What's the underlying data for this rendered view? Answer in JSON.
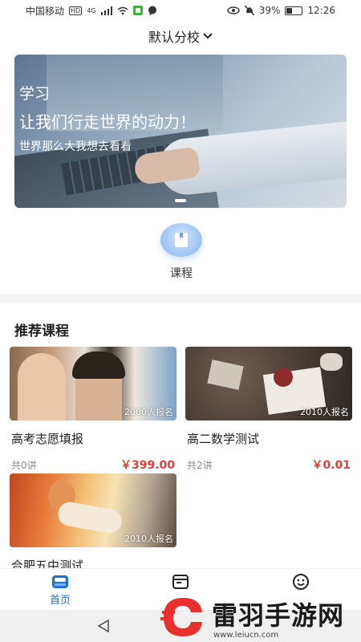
{
  "status_bar": {
    "carrier": "中国移动",
    "hd_badge": "HD",
    "network": "4G",
    "battery_percent": "39%",
    "battery_level": 0.39,
    "time": "12:26"
  },
  "header": {
    "campus": "默认分校"
  },
  "banner": {
    "line1": "学习",
    "line2": "让我们行走世界的动力！",
    "line3": "世界那么大我想去看看"
  },
  "quick_nav": {
    "course_label": "课程"
  },
  "section": {
    "title": "推荐课程",
    "courses": [
      {
        "title": "高考志愿填报",
        "enrolled": "2000人报名",
        "lessons": "共0讲",
        "price": "￥399.00"
      },
      {
        "title": "高二数学测试",
        "enrolled": "2010人报名",
        "lessons": "共2讲",
        "price": "￥0.01"
      },
      {
        "title": "合肥五中测试",
        "enrolled": "2010人报名"
      }
    ]
  },
  "bottom_nav": {
    "home_label": "首页",
    "accent": "#1e6fd9"
  },
  "watermark": {
    "title": "雷羽手游网",
    "url": "www.leiucn.com"
  },
  "colors": {
    "price": "#e23c3c",
    "accent": "#1e6fd9"
  }
}
